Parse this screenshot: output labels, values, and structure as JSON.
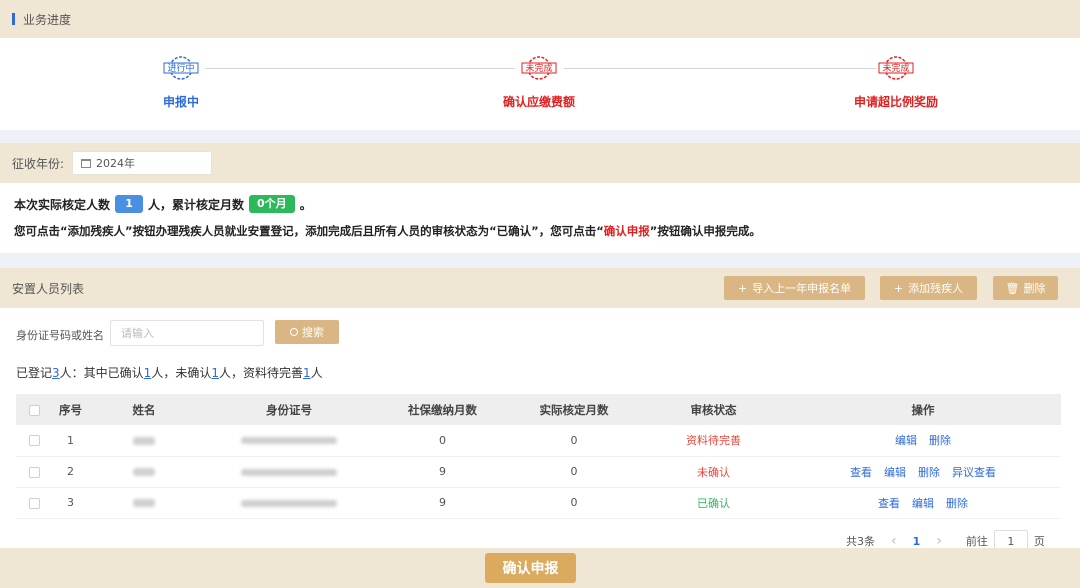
{
  "progress": {
    "title": "业务进度",
    "steps": [
      {
        "badge": "进行中",
        "label": "申报中",
        "color": "#2f6bd8"
      },
      {
        "badge": "未完成",
        "label": "确认应缴费额",
        "color": "#e02020"
      },
      {
        "badge": "未完成",
        "label": "申请超比例奖励",
        "color": "#e02020"
      }
    ]
  },
  "year": {
    "label": "征收年份:",
    "value": "2024年"
  },
  "info": {
    "line1_prefix": "本次实际核定人数",
    "count": "1",
    "line1_mid": "人，累计核定月数",
    "months": "0个月",
    "line1_suffix": "。",
    "line2_prefix": "您可点击“添加残疾人”按钮办理残疾人员就业安置登记，添加完成后且所有人员的审核状态为“已确认”，您可点击“",
    "line2_highlight": "确认申报",
    "line2_suffix": "”按钮确认申报完成。"
  },
  "list": {
    "title": "安置人员列表",
    "btn_import": "导入上一年申报名单",
    "btn_add": "添加残疾人",
    "btn_delete": "删除",
    "search_label": "身份证号码或姓名",
    "search_placeholder": "请输入",
    "search_btn": "搜索",
    "summary": {
      "t1": "已登记",
      "n1": "3",
      "t2": "人：其中已确认",
      "n2": "1",
      "t3": "人，未确认",
      "n3": "1",
      "t4": "人，资料待完善",
      "n4": "1",
      "t5": "人"
    },
    "columns": [
      "序号",
      "姓名",
      "身份证号",
      "社保缴纳月数",
      "实际核定月数",
      "审核状态",
      "操作"
    ],
    "rows": [
      {
        "seq": "1",
        "social_months": "0",
        "approved_months": "0",
        "status": "资料待完善",
        "status_color": "#e8463b",
        "ops": [
          "编辑",
          "删除"
        ]
      },
      {
        "seq": "2",
        "social_months": "9",
        "approved_months": "0",
        "status": "未确认",
        "status_color": "#e8463b",
        "ops": [
          "查看",
          "编辑",
          "删除",
          "异议查看"
        ]
      },
      {
        "seq": "3",
        "social_months": "9",
        "approved_months": "0",
        "status": "已确认",
        "status_color": "#2eb85c",
        "ops": [
          "查看",
          "编辑",
          "删除"
        ]
      }
    ],
    "pager": {
      "total": "共3条",
      "prev": "‹",
      "page": "1",
      "next": "›",
      "goto": "前往",
      "goto_value": "1",
      "suffix": "页"
    }
  },
  "footer": {
    "confirm": "确认申报"
  }
}
